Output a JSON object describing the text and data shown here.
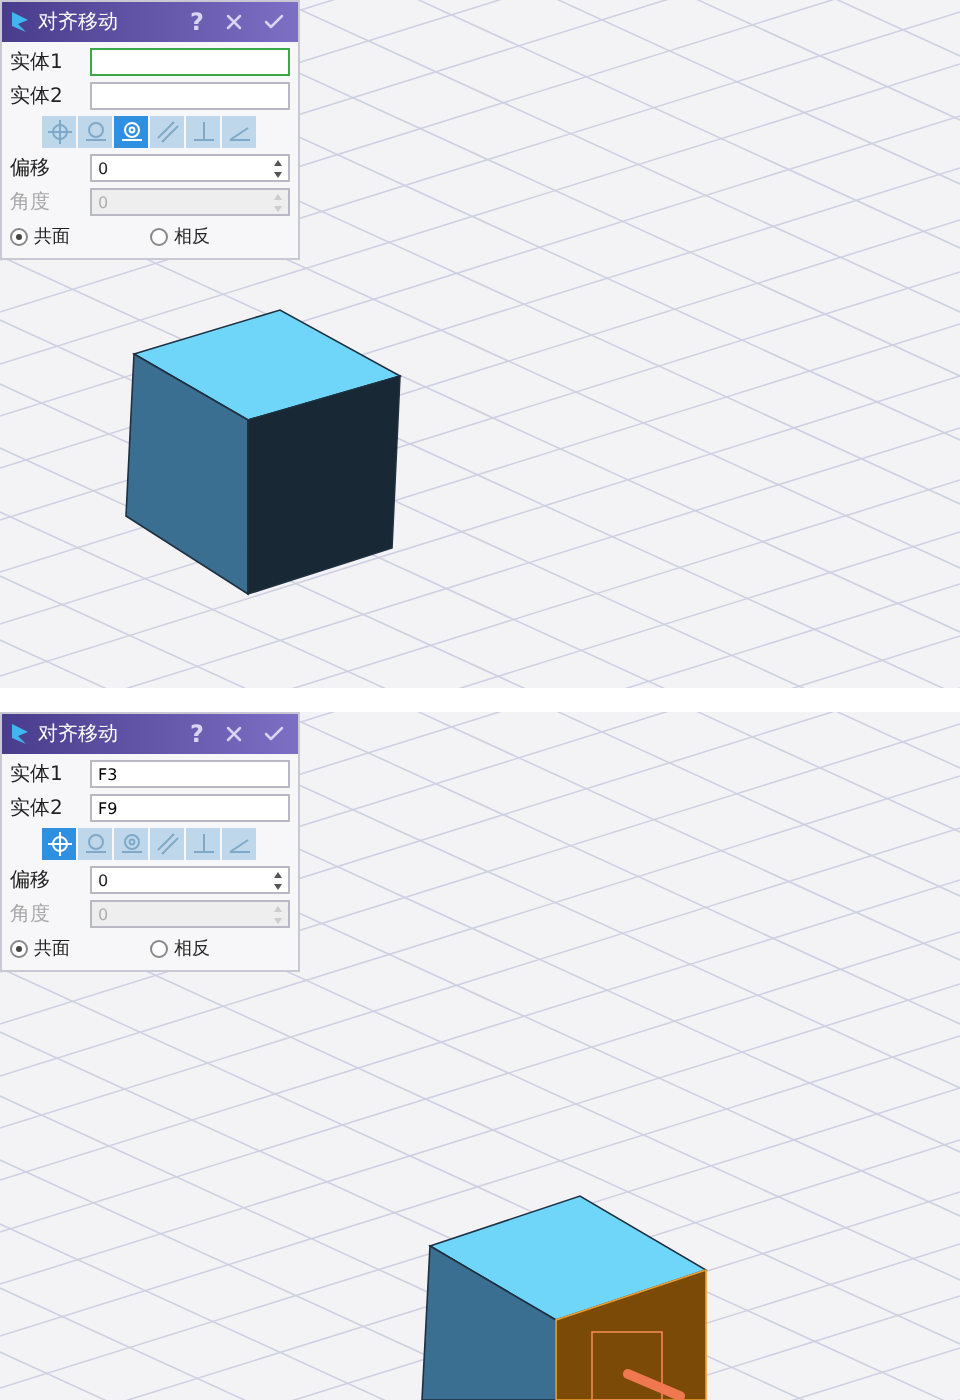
{
  "views": [
    {
      "face_selected": false,
      "dialog": {
        "title": "对齐移动",
        "help": "?",
        "fields": [
          {
            "label": "实体1",
            "focused": true
          },
          {
            "label": "实体2",
            "focused": false
          }
        ],
        "tools": [
          {
            "kind": "crosshair",
            "selected": false
          },
          {
            "kind": "circle",
            "selected": false
          },
          {
            "kind": "target",
            "selected": true
          },
          {
            "kind": "parallel",
            "selected": false
          },
          {
            "kind": "perpendicular",
            "selected": false
          },
          {
            "kind": "angle",
            "selected": false
          }
        ],
        "spinners": [
          {
            "label": "偏移",
            "value": "0",
            "disabled": false
          },
          {
            "label": "角度",
            "value": "0",
            "disabled": true
          }
        ],
        "radios": [
          {
            "label": "共面",
            "selected": true
          },
          {
            "label": "相反",
            "selected": false
          }
        ]
      }
    },
    {
      "face_selected": true,
      "dialog": {
        "title": "对齐移动",
        "help": "?",
        "fields": [
          {
            "label": "实体1",
            "value": "F3",
            "focused": false
          },
          {
            "label": "实体2",
            "value": "F9",
            "focused": false
          }
        ],
        "tools": [
          {
            "kind": "crosshair",
            "selected": true
          },
          {
            "kind": "circle",
            "selected": false
          },
          {
            "kind": "target",
            "selected": false
          },
          {
            "kind": "parallel",
            "selected": false
          },
          {
            "kind": "perpendicular",
            "selected": false
          },
          {
            "kind": "angle",
            "selected": false
          }
        ],
        "spinners": [
          {
            "label": "偏移",
            "value": "0",
            "disabled": false
          },
          {
            "label": "角度",
            "value": "0",
            "disabled": true
          }
        ],
        "radios": [
          {
            "label": "共面",
            "selected": true
          },
          {
            "label": "相反",
            "selected": false
          }
        ]
      }
    }
  ]
}
